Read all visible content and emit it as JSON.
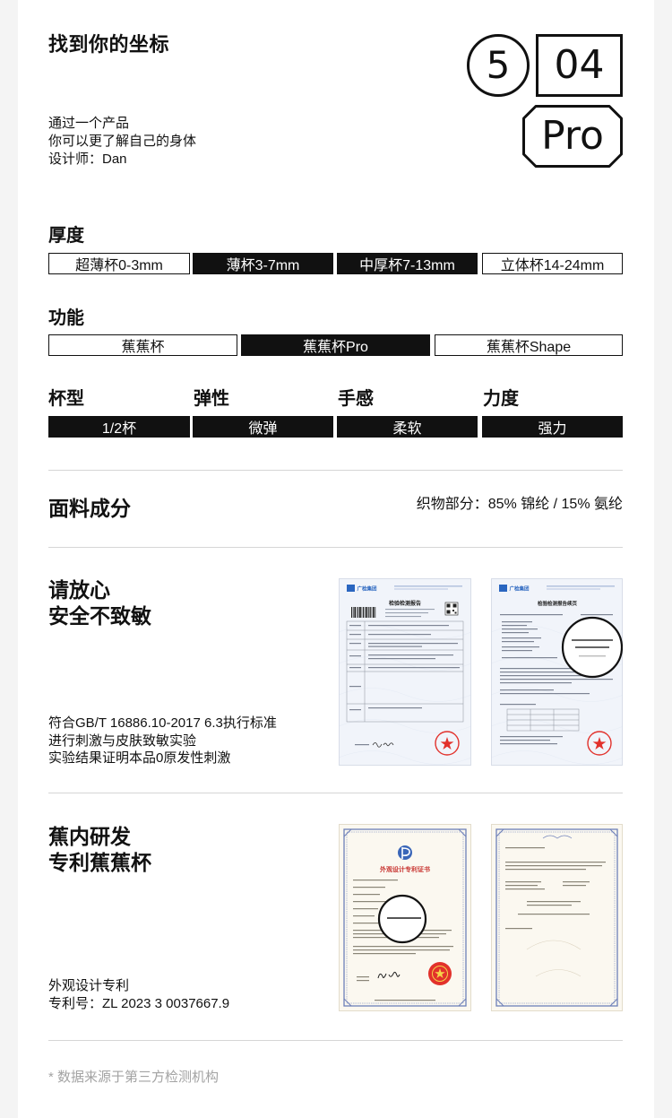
{
  "header": {
    "title": "找到你的坐标",
    "series_number": "5",
    "model_number": "04",
    "edition": "Pro",
    "intro_lines": [
      "通过一个产品",
      "你可以更了解自己的身体",
      "设计师：Dan"
    ]
  },
  "thickness": {
    "label": "厚度",
    "options": [
      {
        "label": "超薄杯0-3mm",
        "selected": false
      },
      {
        "label": "薄杯3-7mm",
        "selected": true
      },
      {
        "label": "中厚杯7-13mm",
        "selected": true
      },
      {
        "label": "立体杯14-24mm",
        "selected": false
      }
    ]
  },
  "function": {
    "label": "功能",
    "options": [
      {
        "label": "蕉蕉杯",
        "selected": false
      },
      {
        "label": "蕉蕉杯Pro",
        "selected": true
      },
      {
        "label": "蕉蕉杯Shape",
        "selected": false
      }
    ]
  },
  "attributes": [
    {
      "label": "杯型",
      "value": "1/2杯"
    },
    {
      "label": "弹性",
      "value": "微弹"
    },
    {
      "label": "手感",
      "value": "柔软"
    },
    {
      "label": "力度",
      "value": "强力"
    }
  ],
  "fabric": {
    "label": "面料成分",
    "composition": "织物部分：85% 锦纶 / 15% 氨纶"
  },
  "safety": {
    "title_lines": [
      "请放心",
      "安全不致敏"
    ],
    "description_lines": [
      "符合GB/T 16886.10-2017 6.3执行标准",
      "进行刺激与皮肤致敏实验",
      "实验结果证明本品0原发性刺激"
    ],
    "certificates": [
      {
        "logo": "广检集团",
        "title": "检验检测报告"
      },
      {
        "logo": "广检集团",
        "title": "检验检测报告续页"
      }
    ]
  },
  "patent": {
    "title_lines": [
      "蕉内研发",
      "专利蕉蕉杯"
    ],
    "description_lines": [
      "外观设计专利",
      "专利号：ZL 2023 3 0037667.9"
    ],
    "certificates": [
      {
        "title": "外观设计专利证书"
      }
    ]
  },
  "footnote": "* 数据来源于第三方检测机构",
  "colors": {
    "text": "#111111",
    "muted": "#a3a3a3",
    "divider": "#d6d6d6",
    "seal_red": "#e2312b",
    "report_blue": "#2a66c0",
    "patent_border_blue": "#6d7fb8"
  }
}
